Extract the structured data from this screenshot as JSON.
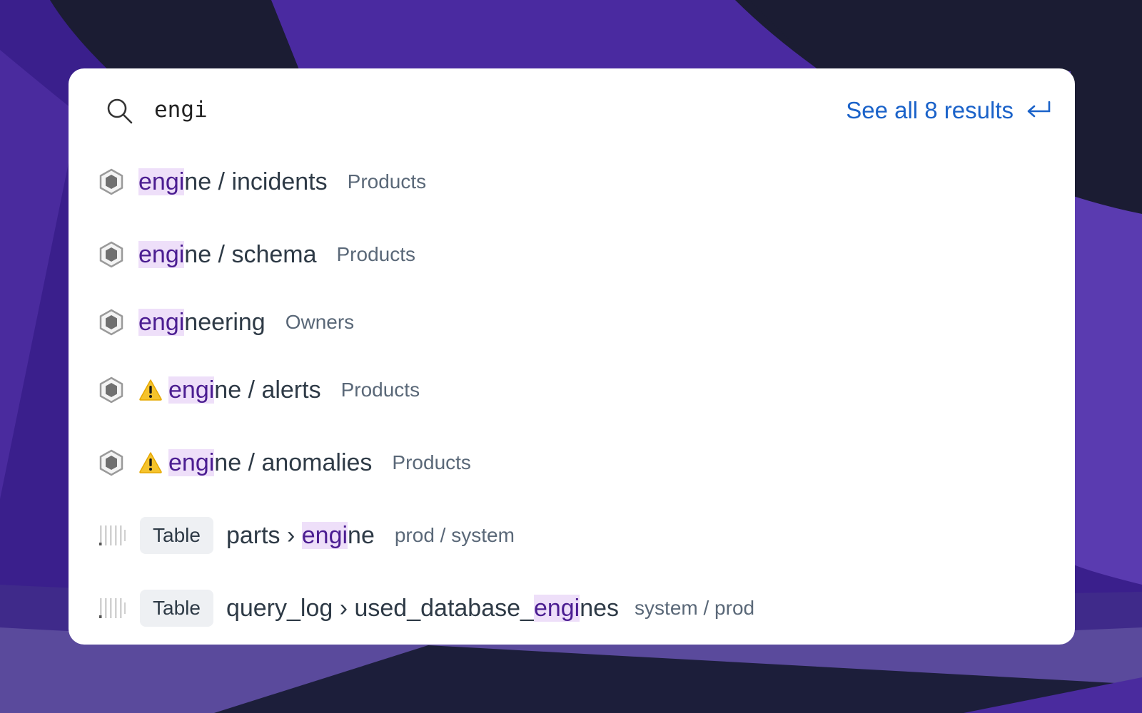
{
  "search": {
    "value": "engi",
    "see_all_label": "See all 8 results"
  },
  "icons": {
    "search": "search-icon",
    "enter": "enter-return-icon",
    "product": "hexagon-icon",
    "warning": "warning-icon",
    "table": "table-columns-icon"
  },
  "colors": {
    "highlight_bg": "#eedff9",
    "highlight_text": "#4b1d91",
    "link": "#1a62c9",
    "warning": "#f5c32c"
  },
  "results": [
    {
      "hl": "engi",
      "rest": "ne / incidents",
      "meta": "Products"
    },
    {
      "hl": "engi",
      "rest": "ne / schema",
      "meta": "Products"
    },
    {
      "hl": "engi",
      "rest": "neering",
      "meta": "Owners"
    },
    {
      "hl": "engi",
      "rest": "ne / alerts",
      "meta": "Products"
    },
    {
      "hl": "engi",
      "rest": "ne / anomalies",
      "meta": "Products"
    },
    {
      "tag": "Table",
      "pre": "parts › ",
      "hl": "engi",
      "rest": "ne",
      "meta": "prod / system"
    },
    {
      "tag": "Table",
      "pre": "query_log › used_database_",
      "hl": "engi",
      "rest": "nes",
      "meta": "system / prod"
    }
  ]
}
